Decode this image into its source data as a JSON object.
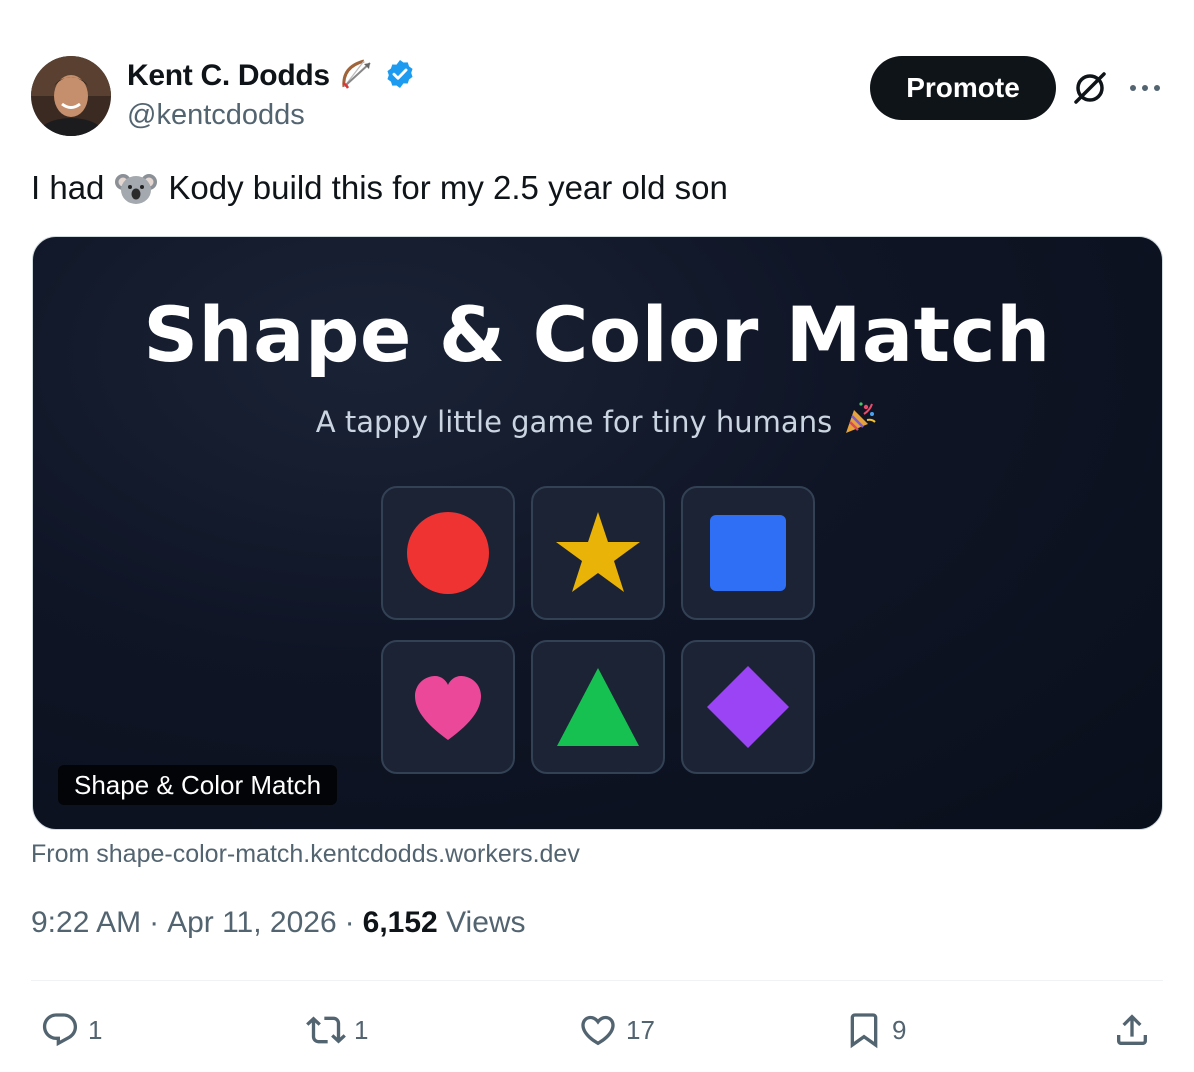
{
  "author": {
    "name": "Kent C. Dodds",
    "handle": "@kentcdodds"
  },
  "header": {
    "promote_label": "Promote"
  },
  "tweet": {
    "text_before": "I had",
    "text_after": "Kody build this for my 2.5 year old son"
  },
  "card": {
    "title": "Shape & Color Match",
    "subtitle": "A tappy little game for tiny humans",
    "label": "Shape & Color Match",
    "source": "From shape-color-match.kentcdodds.workers.dev",
    "shapes": [
      {
        "shape": "circle",
        "color": "#ef3333"
      },
      {
        "shape": "star",
        "color": "#eab308"
      },
      {
        "shape": "square",
        "color": "#2f6ff5"
      },
      {
        "shape": "heart",
        "color": "#ec4899"
      },
      {
        "shape": "triangle",
        "color": "#16c152"
      },
      {
        "shape": "diamond",
        "color": "#9b44f5"
      }
    ]
  },
  "meta": {
    "time": "9:22 AM",
    "sep1": "·",
    "date": "Apr 11, 2026",
    "sep2": "·",
    "views_count": "6,152",
    "views_label": "Views"
  },
  "actions": {
    "replies": "1",
    "reposts": "1",
    "likes": "17",
    "bookmarks": "9"
  },
  "colors": {
    "text_primary": "#0f1419",
    "text_secondary": "#536471",
    "verified": "#1d9bf0",
    "card_bg": "#0f1525"
  },
  "icons": [
    "bow-and-arrow-icon",
    "verified-badge-icon",
    "grok-icon",
    "more-icon",
    "koala-icon",
    "party-popper-icon",
    "reply-icon",
    "repost-icon",
    "like-icon",
    "bookmark-icon",
    "share-icon"
  ]
}
